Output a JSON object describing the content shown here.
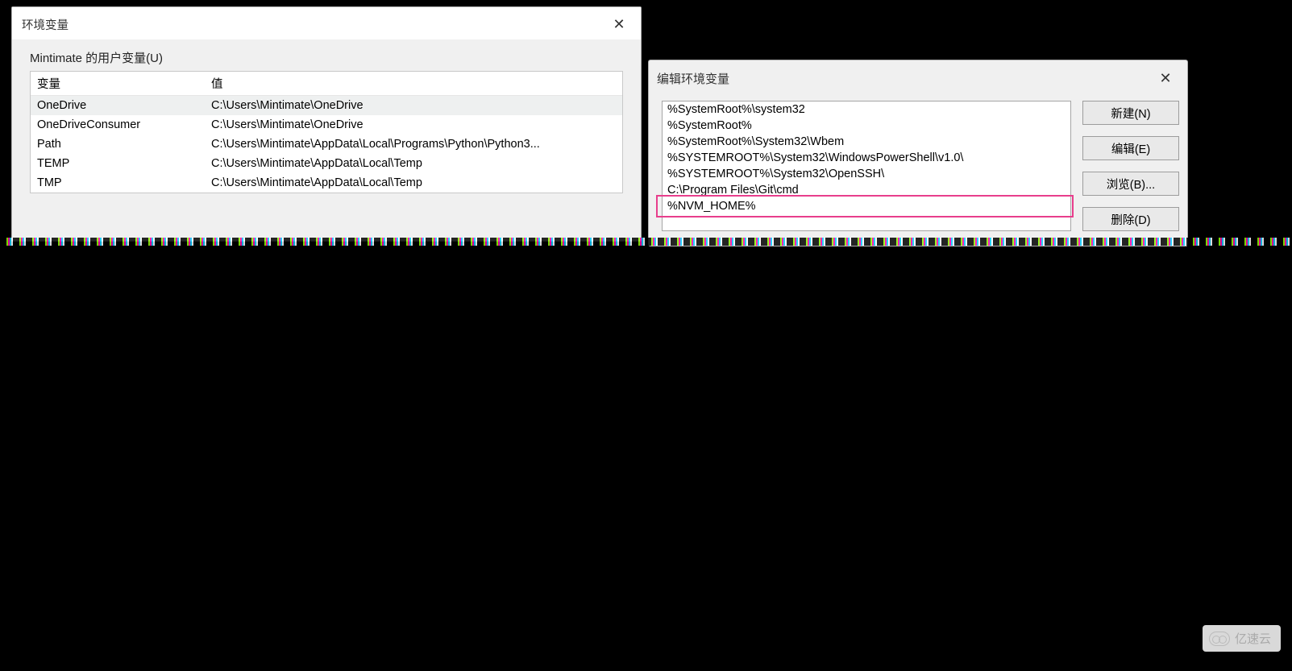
{
  "left_dialog": {
    "title": "环境变量",
    "section_label": "Mintimate 的用户变量(U)",
    "columns": {
      "variable": "变量",
      "value": "值"
    },
    "rows": [
      {
        "variable": "OneDrive",
        "value": "C:\\Users\\Mintimate\\OneDrive",
        "selected": true
      },
      {
        "variable": "OneDriveConsumer",
        "value": "C:\\Users\\Mintimate\\OneDrive"
      },
      {
        "variable": "Path",
        "value": "C:\\Users\\Mintimate\\AppData\\Local\\Programs\\Python\\Python3..."
      },
      {
        "variable": "TEMP",
        "value": "C:\\Users\\Mintimate\\AppData\\Local\\Temp"
      },
      {
        "variable": "TMP",
        "value": "C:\\Users\\Mintimate\\AppData\\Local\\Temp"
      }
    ]
  },
  "right_dialog": {
    "title": "编辑环境变量",
    "list": [
      "%SystemRoot%\\system32",
      "%SystemRoot%",
      "%SystemRoot%\\System32\\Wbem",
      "%SYSTEMROOT%\\System32\\WindowsPowerShell\\v1.0\\",
      "%SYSTEMROOT%\\System32\\OpenSSH\\",
      "C:\\Program Files\\Git\\cmd",
      "%NVM_HOME%"
    ],
    "highlighted_index": 6,
    "buttons": {
      "new": "新建(N)",
      "edit": "编辑(E)",
      "browse": "浏览(B)...",
      "delete": "删除(D)"
    }
  },
  "watermark": {
    "text": "亿速云"
  }
}
